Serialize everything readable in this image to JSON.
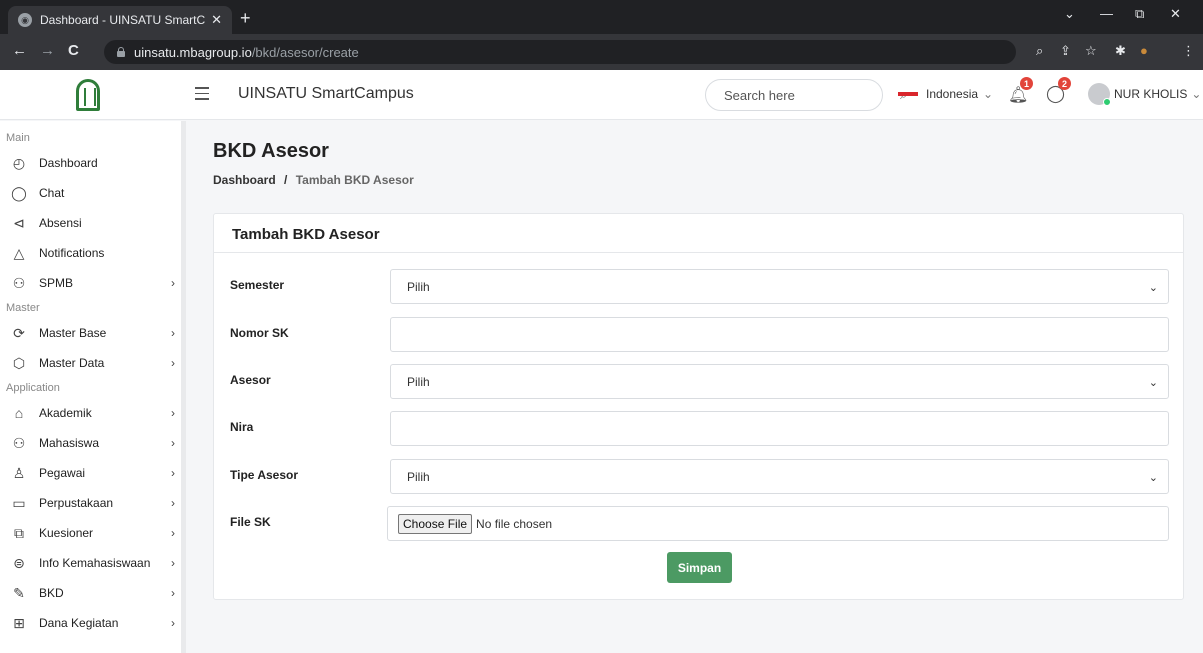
{
  "browser": {
    "tab_title": "Dashboard - UINSATU SmartCam",
    "tab_close": "✕",
    "new_tab": "+",
    "url_host": "uinsatu.mbagroup.io",
    "url_path": "/bkd/asesor/create",
    "nav": {
      "back": "←",
      "forward": "→",
      "reload": "C"
    },
    "window": {
      "minimize": "—",
      "restore": "⧉",
      "close": "✕",
      "tabs_menu": "⌄"
    },
    "toolbar_icons": {
      "zoom": "⌕",
      "share": "⇪",
      "star": "☆",
      "extensions": "✱",
      "profile": "●",
      "menu": "⋮"
    }
  },
  "header": {
    "brand": "UINSATU SmartCampus",
    "search_placeholder": "Search here",
    "search_icon": "⌕",
    "language": "Indonesia",
    "lang_caret": "⌄",
    "notif_count": "1",
    "chat_count": "2",
    "user_name": "NUR KHOLIS",
    "user_caret": "⌄",
    "colors": {
      "brand_green": "#2f7d3a",
      "badge_red": "#e2443a"
    }
  },
  "sidebar": {
    "groups": [
      {
        "label": "Main",
        "items": [
          {
            "label": "Dashboard",
            "icon": "◴",
            "has_children": false
          },
          {
            "label": "Chat",
            "icon": "◯",
            "has_children": false
          },
          {
            "label": "Absensi",
            "icon": "⊲",
            "has_children": false
          },
          {
            "label": "Notifications",
            "icon": "△",
            "has_children": false
          },
          {
            "label": "SPMB",
            "icon": "⚇",
            "has_children": true
          }
        ]
      },
      {
        "label": "Master",
        "items": [
          {
            "label": "Master Base",
            "icon": "⟳",
            "has_children": true
          },
          {
            "label": "Master Data",
            "icon": "⬡",
            "has_children": true
          }
        ]
      },
      {
        "label": "Application",
        "items": [
          {
            "label": "Akademik",
            "icon": "⌂",
            "has_children": true
          },
          {
            "label": "Mahasiswa",
            "icon": "⚇",
            "has_children": true
          },
          {
            "label": "Pegawai",
            "icon": "♙",
            "has_children": true
          },
          {
            "label": "Perpustakaan",
            "icon": "▭",
            "has_children": true
          },
          {
            "label": "Kuesioner",
            "icon": "⧉",
            "has_children": true
          },
          {
            "label": "Info Kemahasiswaan",
            "icon": "⊜",
            "has_children": true
          },
          {
            "label": "BKD",
            "icon": "✎",
            "has_children": true
          },
          {
            "label": "Dana Kegiatan",
            "icon": "⊞",
            "has_children": true
          }
        ]
      }
    ],
    "chevron": "›"
  },
  "page": {
    "title": "BKD Asesor",
    "breadcrumb_home": "Dashboard",
    "breadcrumb_sep": "/",
    "breadcrumb_current": "Tambah BKD Asesor",
    "card_title": "Tambah BKD Asesor",
    "form": {
      "semester_label": "Semester",
      "semester_value": "Pilih",
      "nomor_sk_label": "Nomor SK",
      "nomor_sk_value": "",
      "asesor_label": "Asesor",
      "asesor_value": "Pilih",
      "nira_label": "Nira",
      "nira_value": "",
      "tipe_label": "Tipe Asesor",
      "tipe_value": "Pilih",
      "file_label": "File SK",
      "file_button": "Choose File",
      "file_status": "No file chosen",
      "select_caret": "⌄",
      "submit": "Simpan"
    },
    "colors": {
      "submit_green": "#4c9a63"
    }
  }
}
